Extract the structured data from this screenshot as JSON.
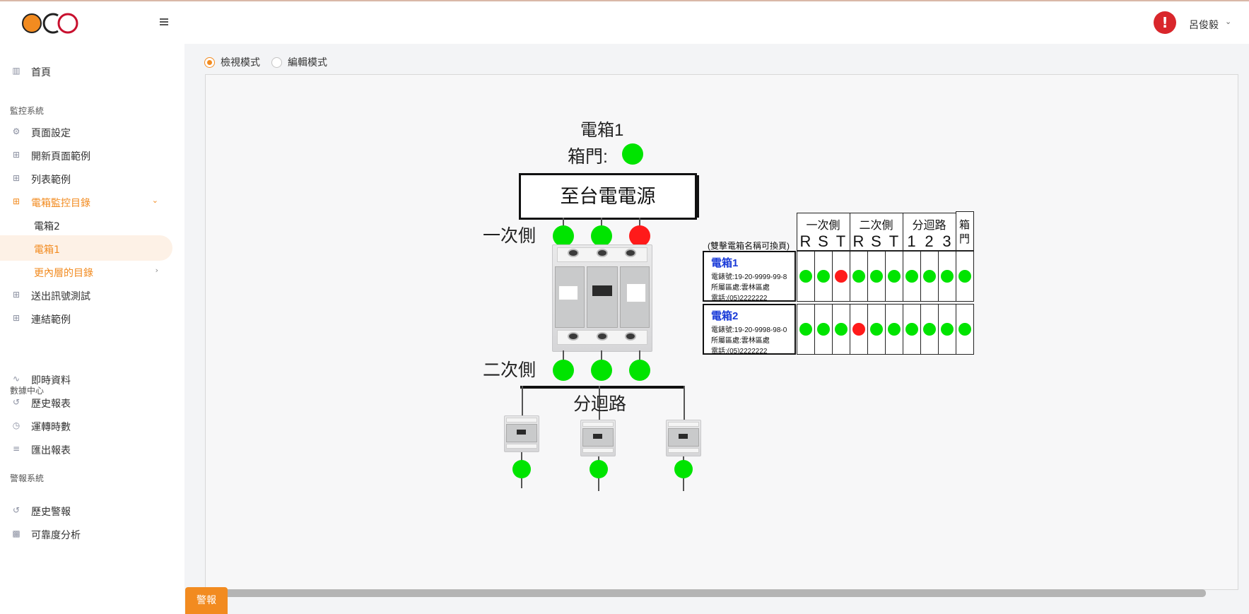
{
  "header": {
    "logo_text": "OCO",
    "user_name": "呂俊毅",
    "alert_symbol": "!"
  },
  "sidebar": {
    "home": "首頁",
    "section_monitor": "監控系統",
    "page_settings": "頁面設定",
    "new_page_example": "開新頁面範例",
    "list_example": "列表範例",
    "box_directory": "電箱監控目錄",
    "box2": "電箱2",
    "box1": "電箱1",
    "deeper_directory": "更內層的目錄",
    "send_signal_test": "送出訊號測試",
    "link_example": "連結範例",
    "section_data": "數據中心",
    "realtime_data": "即時資料",
    "history_report": "歷史報表",
    "running_hours": "運轉時數",
    "export_report": "匯出報表",
    "section_alarm": "警報系統",
    "history_alarm": "歷史警報",
    "reliability_analysis": "可靠度分析"
  },
  "main": {
    "mode_view": "檢視模式",
    "mode_edit": "編輯模式",
    "alarm_button": "警報"
  },
  "diagram": {
    "title": "電箱1",
    "door_label": "箱門:",
    "power_source": "至台電電源",
    "primary_label": "一次側",
    "secondary_label": "二次側",
    "branch_label": "分迴路",
    "door_status": "green",
    "primary_status": [
      "green",
      "green",
      "red"
    ],
    "secondary_status": [
      "green",
      "green",
      "green"
    ],
    "branch_status": [
      "green",
      "green",
      "green"
    ]
  },
  "status_table": {
    "hint": "(雙擊電箱名稱可換頁)",
    "group_primary": "一次側",
    "group_secondary": "二次側",
    "group_branch": "分迴路",
    "door_header_1": "箱",
    "door_header_2": "門",
    "columns": [
      "R",
      "S",
      "T",
      "R",
      "S",
      "T",
      "1",
      "2",
      "3"
    ],
    "boxes": [
      {
        "name": "電箱1",
        "meter": "電錶號:19-20-9999-99-8",
        "district": "所屬區處:雲林區處",
        "phone": "電話:(05)2222222",
        "status": [
          "green",
          "green",
          "red",
          "green",
          "green",
          "green",
          "green",
          "green",
          "green",
          "green"
        ]
      },
      {
        "name": "電箱2",
        "meter": "電錶號:19-20-9998-98-0",
        "district": "所屬區處:雲林區處",
        "phone": "電話:(05)2222222",
        "status": [
          "green",
          "green",
          "green",
          "red",
          "green",
          "green",
          "green",
          "green",
          "green",
          "green"
        ]
      }
    ]
  }
}
